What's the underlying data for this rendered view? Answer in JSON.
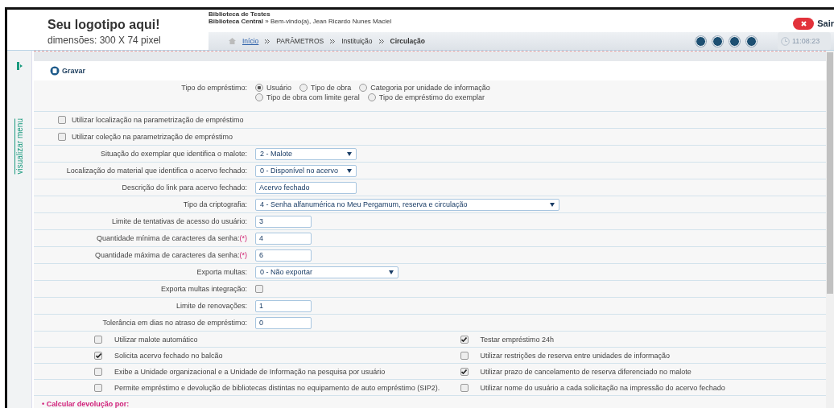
{
  "header": {
    "logo_title": "Seu logotipo aqui!",
    "logo_subtitle": "dimensões: 300 X 74 pixel",
    "library": "Biblioteca de Testes",
    "unit": "Biblioteca Central",
    "welcome": "» Bem-vindo(a), Jean Ricardo Nunes Maciel",
    "logout": "Sair",
    "clock": "11:08:23"
  },
  "breadcrumb": [
    {
      "label": "Início",
      "kind": "link"
    },
    {
      "label": "PARÂMETROS",
      "kind": "plain"
    },
    {
      "label": "Instituição",
      "kind": "plain"
    },
    {
      "label": "Circulação",
      "kind": "current"
    }
  ],
  "sidebar": {
    "toggle_label": "visualizar menu"
  },
  "toolbar": {
    "save": "Gravar"
  },
  "loan_type": {
    "label": "Tipo do empréstimo:",
    "options": [
      {
        "label": "Usuário",
        "selected": true
      },
      {
        "label": "Tipo de obra",
        "selected": false
      },
      {
        "label": "Categoria por unidade de informação",
        "selected": false
      },
      {
        "label": "Tipo de obra com limite geral",
        "selected": false
      },
      {
        "label": "Tipo de empréstimo do exemplar",
        "selected": false
      }
    ]
  },
  "top_checks": [
    {
      "label": "Utilizar localização na parametrização de empréstimo",
      "checked": false
    },
    {
      "label": "Utilizar coleção na parametrização de empréstimo",
      "checked": false
    }
  ],
  "fields": [
    {
      "kind": "select",
      "label": "Situação do exemplar que identifica o malote:",
      "value": "2 - Malote"
    },
    {
      "kind": "select",
      "label": "Localização do material que identifica o acervo fechado:",
      "value": "0 - Disponível no acervo"
    },
    {
      "kind": "text",
      "label": "Descrição do link para acervo fechado:",
      "value": "Acervo fechado"
    },
    {
      "kind": "select",
      "label": "Tipo da criptografia:",
      "value": "4 - Senha alfanumérica no Meu Pergamum, reserva e circulação"
    },
    {
      "kind": "text",
      "label": "Limite de tentativas de acesso do usuário:",
      "value": "3"
    },
    {
      "kind": "text",
      "label": "Quantidade mínima de caracteres da senha:",
      "required_mark": "(*)",
      "value": "4"
    },
    {
      "kind": "text",
      "label": "Quantidade máxima de caracteres da senha:",
      "required_mark": "(*)",
      "value": "6"
    },
    {
      "kind": "select",
      "label": "Exporta multas:",
      "value": "0 - Não exportar"
    },
    {
      "kind": "checkbox",
      "label": "Exporta multas integração:",
      "checked": false
    },
    {
      "kind": "text",
      "label": "Limite de renovações:",
      "value": "1"
    },
    {
      "kind": "text",
      "label": "Tolerância em dias no atraso de empréstimo:",
      "value": "0"
    }
  ],
  "option_rows": [
    [
      {
        "label": "Utilizar malote automático",
        "checked": false
      },
      {
        "label": "Testar empréstimo 24h",
        "checked": true
      }
    ],
    [
      {
        "label": "Solicita acervo fechado no balcão",
        "checked": true
      },
      {
        "label": "Utilizar restrições de reserva entre unidades de informação",
        "checked": false
      }
    ],
    [
      {
        "label": "Exibe a Unidade organizacional e a Unidade de Informação na pesquisa por usuário",
        "checked": false
      },
      {
        "label": "Utilizar prazo de cancelamento de reserva diferenciado no malote",
        "checked": true
      }
    ],
    [
      {
        "label": "Permite empréstimo e devolução de bibliotecas distintas no equipamento de auto empréstimo (SIP2).",
        "checked": false
      },
      {
        "label": "Utilizar nome do usuário a cada solicitação na impressão do acervo fechado",
        "checked": false
      }
    ]
  ],
  "section": {
    "title": "• Calcular devolução por:"
  }
}
